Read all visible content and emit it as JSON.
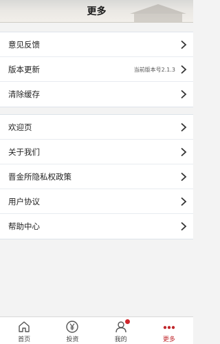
{
  "header": {
    "title": "更多"
  },
  "groups": [
    {
      "items": [
        {
          "label": "意见反馈"
        },
        {
          "label": "版本更新",
          "value": "当前版本号2.1.3"
        },
        {
          "label": "清除缓存"
        }
      ]
    },
    {
      "items": [
        {
          "label": "欢迎页"
        },
        {
          "label": "关于我们"
        },
        {
          "label": "晋金所隐私权政策"
        },
        {
          "label": "用户协议"
        },
        {
          "label": "帮助中心"
        }
      ]
    }
  ],
  "tabbar": {
    "active_color": "#c0282d",
    "badge_color": "#d0262c",
    "tabs": [
      {
        "label": "首页",
        "icon": "home-icon"
      },
      {
        "label": "投资",
        "icon": "yuan-coin-icon"
      },
      {
        "label": "我的",
        "icon": "user-icon",
        "badge": true
      },
      {
        "label": "更多",
        "icon": "more-dots-icon",
        "active": true
      }
    ]
  }
}
